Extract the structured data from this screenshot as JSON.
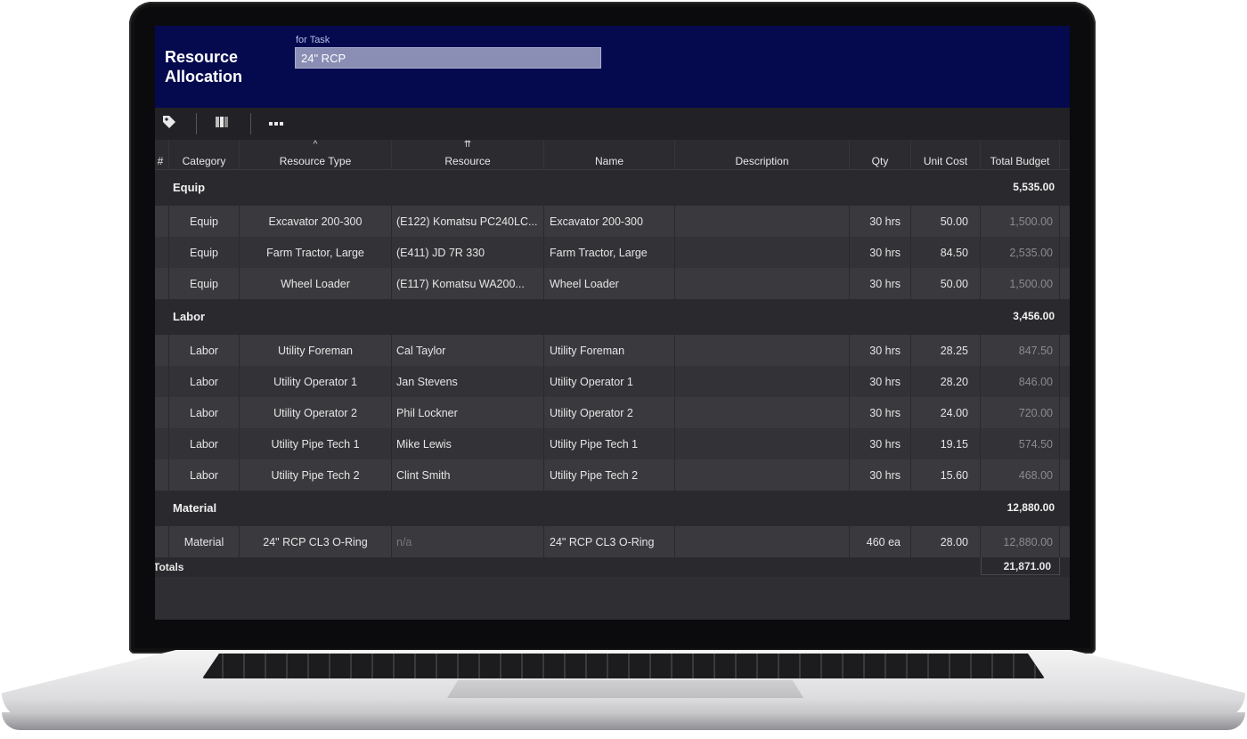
{
  "app": {
    "title": "Resource Allocation",
    "task_label": "for Task",
    "task_value": "24\" RCP"
  },
  "toolbar": {
    "icons": [
      "tag-icon",
      "columns-icon",
      "more-options-icon"
    ]
  },
  "columns": {
    "num": "#",
    "category": "Category",
    "resource_type": "Resource Type",
    "resource": "Resource",
    "name": "Name",
    "description": "Description",
    "qty": "Qty",
    "unit_cost": "Unit Cost",
    "total_budget": "Total Budget",
    "sort_resource_type": "^",
    "sort_resource": "⇈"
  },
  "groups": [
    {
      "label": "Equip",
      "total": "5,535.00",
      "rows": [
        {
          "category": "Equip",
          "resource_type": "Excavator 200-300",
          "resource": "(E122) Komatsu PC240LC...",
          "name": "Excavator 200-300",
          "qty": "30  hrs",
          "unit_cost": "50.00",
          "total": "1,500.00"
        },
        {
          "category": "Equip",
          "resource_type": "Farm Tractor, Large",
          "resource": "(E411) JD 7R 330",
          "name": "Farm Tractor, Large",
          "qty": "30  hrs",
          "unit_cost": "84.50",
          "total": "2,535.00"
        },
        {
          "category": "Equip",
          "resource_type": "Wheel Loader",
          "resource": "(E117) Komatsu WA200...",
          "name": "Wheel Loader",
          "qty": "30  hrs",
          "unit_cost": "50.00",
          "total": "1,500.00"
        }
      ]
    },
    {
      "label": "Labor",
      "total": "3,456.00",
      "rows": [
        {
          "category": "Labor",
          "resource_type": "Utility Foreman",
          "resource": "Cal Taylor",
          "name": "Utility Foreman",
          "qty": "30  hrs",
          "unit_cost": "28.25",
          "total": "847.50"
        },
        {
          "category": "Labor",
          "resource_type": "Utility Operator 1",
          "resource": "Jan Stevens",
          "name": "Utility Operator 1",
          "qty": "30  hrs",
          "unit_cost": "28.20",
          "total": "846.00"
        },
        {
          "category": "Labor",
          "resource_type": "Utility Operator 2",
          "resource": "Phil Lockner",
          "name": "Utility Operator 2",
          "qty": "30  hrs",
          "unit_cost": "24.00",
          "total": "720.00"
        },
        {
          "category": "Labor",
          "resource_type": "Utility Pipe Tech 1",
          "resource": "Mike Lewis",
          "name": "Utility Pipe Tech 1",
          "qty": "30  hrs",
          "unit_cost": "19.15",
          "total": "574.50"
        },
        {
          "category": "Labor",
          "resource_type": "Utility Pipe Tech 2",
          "resource": "Clint Smith",
          "name": "Utility Pipe Tech 2",
          "qty": "30  hrs",
          "unit_cost": "15.60",
          "total": "468.00"
        }
      ]
    },
    {
      "label": "Material",
      "total": "12,880.00",
      "rows": [
        {
          "category": "Material",
          "resource_type": "24\" RCP CL3 O-Ring",
          "resource": "n/a",
          "name": "24\" RCP CL3 O-Ring",
          "qty": "460  ea",
          "unit_cost": "28.00",
          "total": "12,880.00"
        }
      ]
    }
  ],
  "totals": {
    "label": "Totals",
    "value": "21,871.00"
  }
}
